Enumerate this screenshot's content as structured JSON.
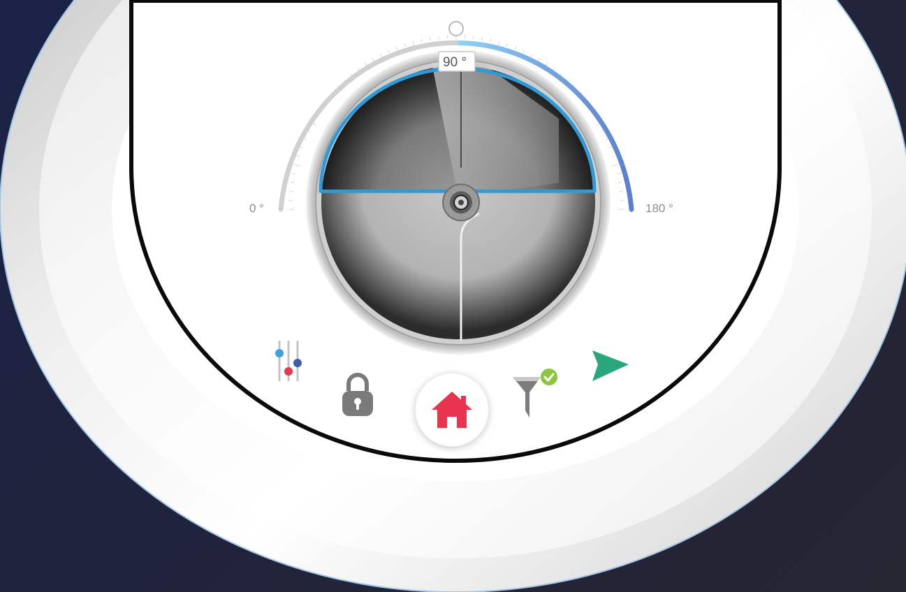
{
  "dial": {
    "min_label": "0 °",
    "max_label": "180 °",
    "current_angle_label": "90 °",
    "current_angle": 90,
    "range": [
      0,
      180
    ],
    "accent_color": "#3a9fd8",
    "arc_gradient_end": "#5b7fcf"
  },
  "controls": {
    "settings": {
      "icon": "sliders-icon"
    },
    "lock": {
      "icon": "lock-icon",
      "color": "#7a7a7a"
    },
    "home": {
      "icon": "home-icon",
      "color": "#e8344e"
    },
    "filter": {
      "icon": "filter-check-icon",
      "check_color": "#8cc63f"
    },
    "play": {
      "icon": "play-icon",
      "color": "#2aa77a"
    }
  }
}
